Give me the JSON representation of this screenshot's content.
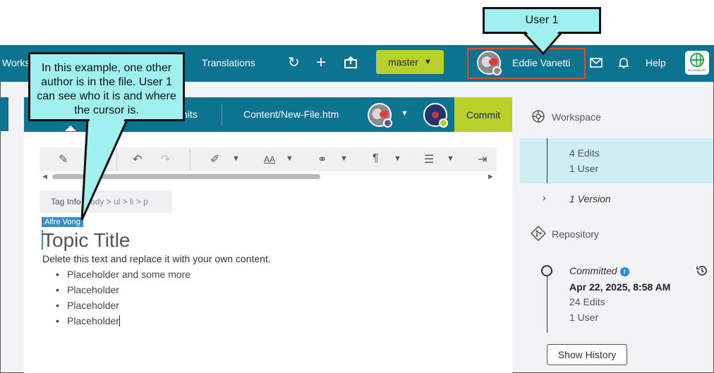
{
  "topbar": {
    "workspace_tab": "Works",
    "translations_tab": "Translations",
    "branch": "master",
    "user_name": "Eddie Vanetti",
    "help": "Help",
    "logo_text": "FICTIONSOFT"
  },
  "editor_tabs": {
    "commits_partial": "nits",
    "file_path": "Content/New-File.htm",
    "commit_button": "Commit"
  },
  "tag_info": {
    "label": "Tag Info:",
    "path": "body > ul > li > p"
  },
  "document": {
    "cursor_author": "Alfre Vong",
    "title": "Topic Title",
    "intro": "Delete this text and replace it with your own content.",
    "bullets": [
      "Placeholder and some more",
      "Placeholder",
      "Placeholder",
      "Placeholder"
    ]
  },
  "right_panel": {
    "workspace_label": "Workspace",
    "workspace_edits": "4 Edits",
    "workspace_users": "1 User",
    "version": "1 Version",
    "repository_label": "Repository",
    "committed_label": "Committed",
    "commit_date": "Apr 22, 2025, 8:58 AM",
    "repo_edits": "24 Edits",
    "repo_users": "1 User",
    "show_history": "Show History"
  },
  "callouts": {
    "user_callout": "User 1",
    "author_callout": "In this example, one other author is in the file. User 1 can see who it is and where the cursor is."
  },
  "colors": {
    "topbar": "#0c7391",
    "accent_green": "#b9cf2a",
    "callout_fill": "#9ff0ee",
    "highlight_border": "#e04b2e",
    "cursor_blue": "#3a8fc4"
  },
  "icons": [
    "refresh-icon",
    "plus-icon",
    "upload-icon",
    "chevron-down-icon",
    "mail-icon",
    "bell-icon",
    "globe-logo-icon",
    "workspace-icon",
    "repository-icon",
    "history-icon",
    "info-icon"
  ]
}
